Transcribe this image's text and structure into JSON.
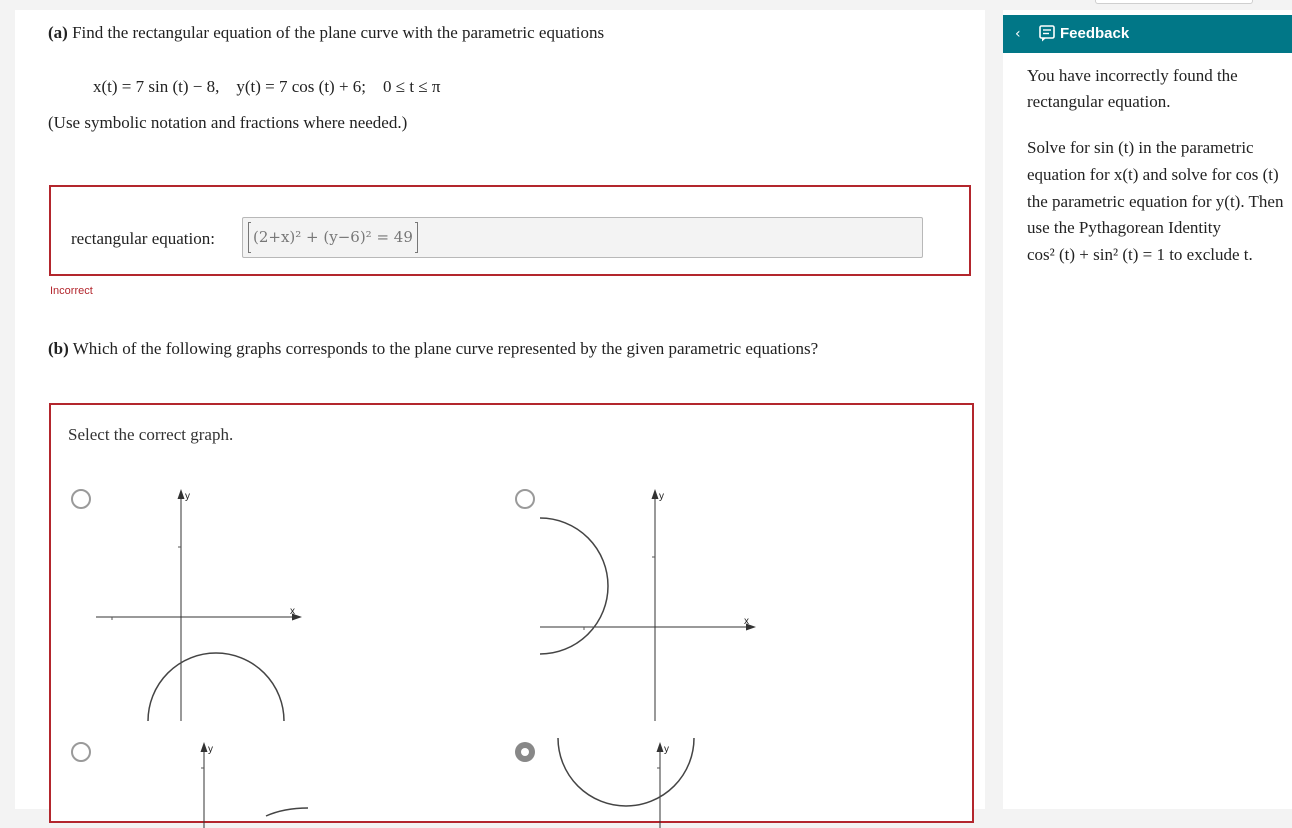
{
  "part_a": {
    "label": "(a)",
    "prompt": "Find the rectangular equation of the plane curve with the parametric equations",
    "x_eq": "x(t) = 7 sin (t) − 8,",
    "y_eq": "y(t) = 7 cos (t) + 6;",
    "range": "0 ≤ t ≤ π",
    "hint": "(Use symbolic notation and fractions where needed.)",
    "answer_label": "rectangular equation:",
    "answer_value": "(2+x)² + (y−6)² = 49",
    "status": "Incorrect"
  },
  "part_b": {
    "label": "(b)",
    "prompt": "Which of the following graphs corresponds to the plane curve represented by the given parametric equations?",
    "select_label": "Select the correct graph.",
    "axis_x": "x",
    "axis_y": "y",
    "options": [
      {
        "id": "option-1",
        "selected": false,
        "curve": "upper semicircle below x-axis"
      },
      {
        "id": "option-2",
        "selected": false,
        "curve": "right semicircle left of y-axis"
      },
      {
        "id": "option-3",
        "selected": false,
        "curve": "partial arc"
      },
      {
        "id": "option-4",
        "selected": true,
        "curve": "lower semicircle"
      }
    ]
  },
  "feedback": {
    "title": "Feedback",
    "line1": "You have incorrectly found the",
    "line2": "rectangular equation.",
    "line3": "Solve for sin (t) in the parametric",
    "line4": "equation for x(t) and solve for cos (t)",
    "line5": "the parametric equation for y(t). Then",
    "line6": "use the Pythagorean Identity",
    "line7": "cos² (t) + sin² (t) = 1 to exclude t."
  },
  "colors": {
    "accent": "#017787",
    "error": "#b3262d"
  }
}
